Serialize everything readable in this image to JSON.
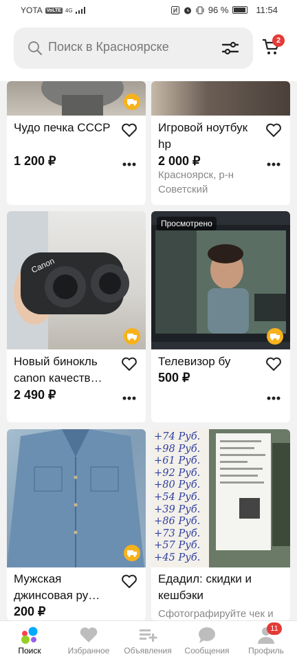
{
  "status_bar": {
    "carrier": "YOTA",
    "volte": "VoLTE",
    "network": "4G",
    "battery": "96 %",
    "time": "11:54"
  },
  "search": {
    "placeholder": "Поиск в Красноярске",
    "cart_count": "2"
  },
  "listings": [
    {
      "title": "Чудо печка СССР",
      "price": "1 200 ₽",
      "location": "",
      "viewed": ""
    },
    {
      "title": "Игровой ноутбук hp",
      "price": "2 000 ₽",
      "location": "Красноярск, р-н Советский",
      "viewed": ""
    },
    {
      "title": "Новый бинокль canon качеств…",
      "price": "2 490 ₽",
      "location": "",
      "viewed": ""
    },
    {
      "title": "Телевизор бу",
      "price": "500 ₽",
      "location": "",
      "viewed": "Просмотрено"
    },
    {
      "title": "Мужская джинсовая ру…",
      "price": "200 ₽",
      "location": "",
      "viewed": ""
    },
    {
      "title": "Едадил: скидки и кешбэки",
      "price": "",
      "location": "Сфотографируйте чек и",
      "viewed": ""
    }
  ],
  "receipt_lines": [
    "+74 Руб.",
    "+98 Руб.",
    "+61 Руб.",
    "+92 Руб.",
    "+80 Руб.",
    "+54 Руб.",
    "+39 Руб.",
    "+86 Руб.",
    "+73 Руб.",
    "+57 Руб.",
    "+45 Руб."
  ],
  "nav": {
    "items": [
      "Поиск",
      "Избранное",
      "Объявления",
      "Сообщения",
      "Профиль"
    ],
    "profile_badge": "11"
  },
  "colors": {
    "accent_badge": "#e53935",
    "delivery": "#f7b21b",
    "nav_search_blue": "#00aaff",
    "nav_search_green": "#97cf26",
    "nav_search_red": "#ff4053",
    "nav_search_purple": "#965eeb"
  }
}
